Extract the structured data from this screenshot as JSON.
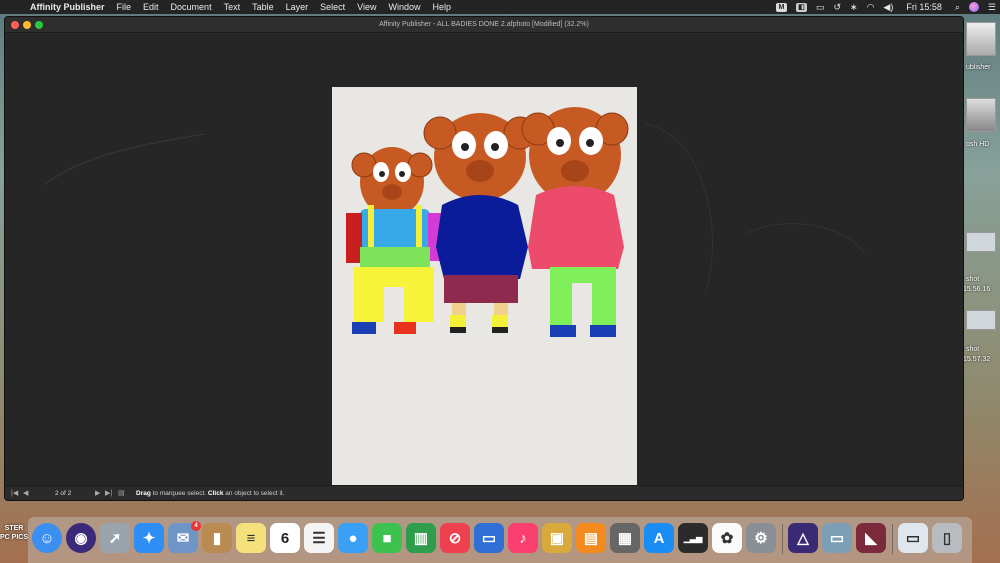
{
  "menubar": {
    "app_name": "Affinity Publisher",
    "items": [
      "File",
      "Edit",
      "Document",
      "Text",
      "Table",
      "Layer",
      "Select",
      "View",
      "Window",
      "Help"
    ],
    "clock": "Fri 15:58"
  },
  "window": {
    "title": "Affinity Publisher - ALL BADIES DONE 2.afphoto [Modified] (32.2%)"
  },
  "statusbar": {
    "page_indicator": "2 of 2",
    "hint_drag": "Drag",
    "hint_drag_text": " to marquee select. ",
    "hint_click": "Click",
    "hint_click_text": " an object to select it."
  },
  "desktop": {
    "labels": [
      "ublisher",
      "osh HD",
      "shot",
      "15.56.16",
      "shot",
      "15.57.32"
    ],
    "left_label": "STER PC PICS"
  },
  "dock": {
    "apps": [
      {
        "name": "Finder",
        "icon": "finder-icon",
        "color": "#3a8ff0"
      },
      {
        "name": "Siri",
        "icon": "siri-icon",
        "color": "#3b2a7a"
      },
      {
        "name": "Launchpad",
        "icon": "launchpad-icon",
        "color": "#9aa4ad"
      },
      {
        "name": "Safari",
        "icon": "safari-icon",
        "color": "#2f8ef5"
      },
      {
        "name": "Mail",
        "icon": "mail-icon",
        "color": "#6f95c7",
        "badge": "4"
      },
      {
        "name": "Contacts",
        "icon": "contacts-icon",
        "color": "#b98a52"
      },
      {
        "name": "Notes",
        "icon": "notes-icon",
        "color": "#f5e17b"
      },
      {
        "name": "Calendar",
        "icon": "calendar-icon",
        "color": "#ffffff",
        "text": "6"
      },
      {
        "name": "Reminders",
        "icon": "reminders-icon",
        "color": "#f4f4f4"
      },
      {
        "name": "Messages",
        "icon": "messages-icon",
        "color": "#3aa0f5"
      },
      {
        "name": "FaceTime",
        "icon": "facetime-icon",
        "color": "#3dc24f"
      },
      {
        "name": "Numbers",
        "icon": "numbers-icon",
        "color": "#2e9e4c"
      },
      {
        "name": "News",
        "icon": "news-icon",
        "color": "#ef4050"
      },
      {
        "name": "Keynote",
        "icon": "keynote-icon",
        "color": "#2f6fd6"
      },
      {
        "name": "iTunes",
        "icon": "itunes-icon",
        "color": "#fa3f6e"
      },
      {
        "name": "Preview",
        "icon": "preview-icon",
        "color": "#d9a93c"
      },
      {
        "name": "Books",
        "icon": "books-icon",
        "color": "#f28a1d"
      },
      {
        "name": "Calculator",
        "icon": "calculator-icon",
        "color": "#666666"
      },
      {
        "name": "App Store",
        "icon": "app-store-icon",
        "color": "#1a8df5"
      },
      {
        "name": "Activity Monitor",
        "icon": "activity-monitor-icon",
        "color": "#2b2b2b"
      },
      {
        "name": "Photos",
        "icon": "photos-icon",
        "color": "#fafafa"
      },
      {
        "name": "System Preferences",
        "icon": "system-preferences-icon",
        "color": "#8a8f96"
      },
      {
        "name": "Affinity Designer",
        "icon": "affinity-designer-icon",
        "color": "#3a2a73"
      },
      {
        "name": "Image Capture",
        "icon": "image-capture-icon",
        "color": "#7d9fb6"
      },
      {
        "name": "Affinity Publisher",
        "icon": "affinity-publisher-icon",
        "color": "#7a2a3a"
      },
      {
        "name": "Downloads",
        "icon": "downloads-icon",
        "color": "#dfe6ee"
      },
      {
        "name": "Trash",
        "icon": "trash-icon",
        "color": "#b8bcc0"
      }
    ]
  }
}
